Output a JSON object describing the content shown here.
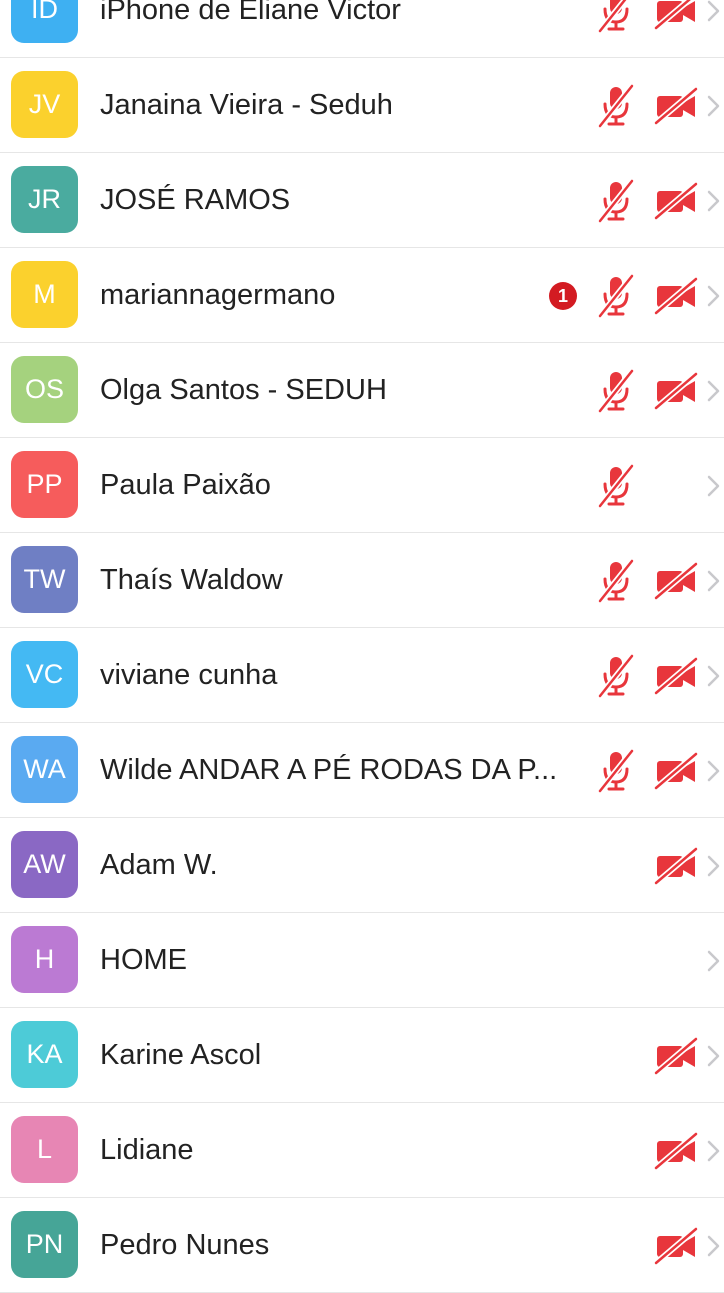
{
  "colors": {
    "muted_red": "#e8363c",
    "badge_red": "#d31b22",
    "chevron": "#c8c8cc",
    "separator": "#e6e6e6"
  },
  "participants": [
    {
      "initials": "ID",
      "name": "iPhone de Eliane Victor",
      "color": "#3eb0f2",
      "mic_muted": true,
      "cam_off": true,
      "badge": null
    },
    {
      "initials": "JV",
      "name": "Janaina Vieira - Seduh",
      "color": "#fbd12d",
      "mic_muted": true,
      "cam_off": true,
      "badge": null
    },
    {
      "initials": "JR",
      "name": "JOSÉ RAMOS",
      "color": "#4aab9f",
      "mic_muted": true,
      "cam_off": true,
      "badge": null
    },
    {
      "initials": "M",
      "name": "mariannagermano",
      "color": "#fbd12d",
      "mic_muted": true,
      "cam_off": true,
      "badge": "1"
    },
    {
      "initials": "OS",
      "name": "Olga Santos - SEDUH",
      "color": "#a5d27e",
      "mic_muted": true,
      "cam_off": true,
      "badge": null
    },
    {
      "initials": "PP",
      "name": "Paula Paixão",
      "color": "#f65c5c",
      "mic_muted": true,
      "cam_off": false,
      "badge": null
    },
    {
      "initials": "TW",
      "name": "Thaís Waldow",
      "color": "#6f7fc4",
      "mic_muted": true,
      "cam_off": true,
      "badge": null
    },
    {
      "initials": "VC",
      "name": "viviane cunha",
      "color": "#44b9f3",
      "mic_muted": true,
      "cam_off": true,
      "badge": null
    },
    {
      "initials": "WA",
      "name": "Wilde ANDAR A PÉ RODAS DA P...",
      "color": "#5aaaf1",
      "mic_muted": true,
      "cam_off": true,
      "badge": null
    },
    {
      "initials": "AW",
      "name": "Adam W.",
      "color": "#8a68c4",
      "mic_muted": false,
      "cam_off": true,
      "badge": null
    },
    {
      "initials": "H",
      "name": "HOME",
      "color": "#bb7ad3",
      "mic_muted": false,
      "cam_off": false,
      "badge": null
    },
    {
      "initials": "KA",
      "name": "Karine Ascol",
      "color": "#4dcbd7",
      "mic_muted": false,
      "cam_off": true,
      "badge": null
    },
    {
      "initials": "L",
      "name": "Lidiane",
      "color": "#e786b4",
      "mic_muted": false,
      "cam_off": true,
      "badge": null
    },
    {
      "initials": "PN",
      "name": "Pedro Nunes",
      "color": "#46a597",
      "mic_muted": false,
      "cam_off": true,
      "badge": null
    }
  ]
}
